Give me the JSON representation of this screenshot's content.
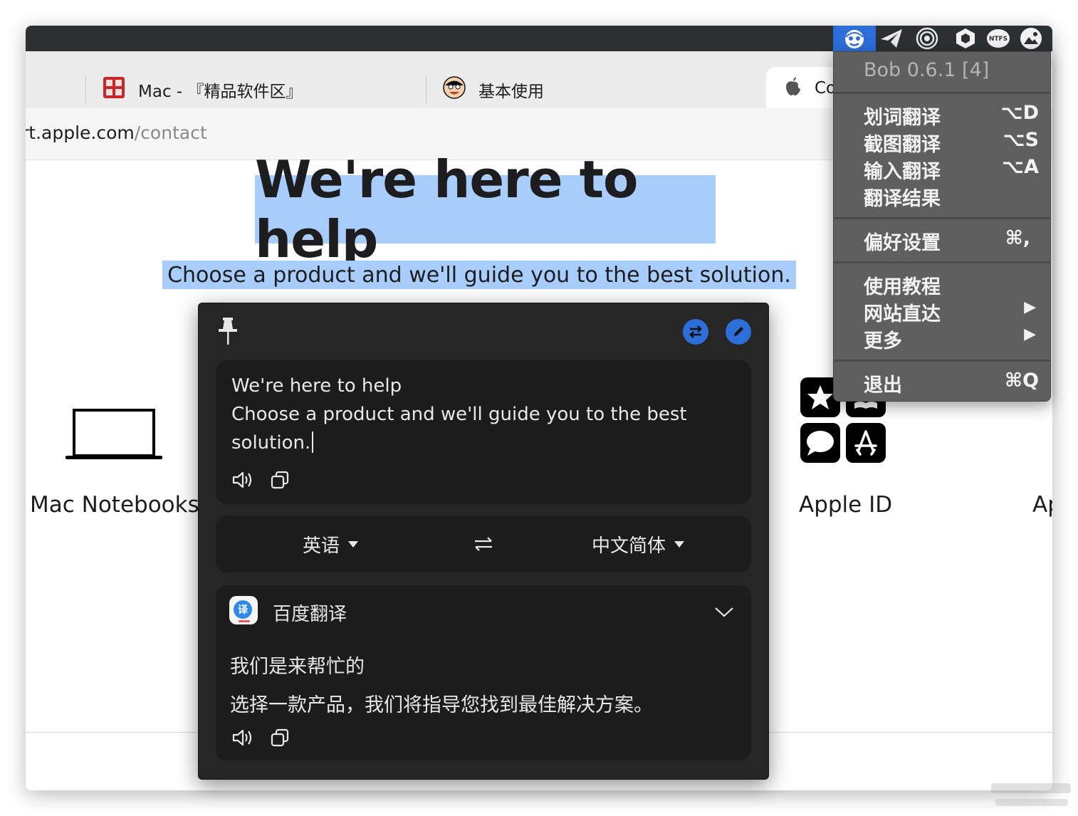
{
  "browser": {
    "tabs": [
      {
        "label": "Mac - 『精品软件区』"
      },
      {
        "label": "基本使用"
      },
      {
        "label": "Co"
      }
    ],
    "address": {
      "host": "rt.apple.com",
      "path": "/contact"
    }
  },
  "page": {
    "title": "We're here to help",
    "subtitle": "Choose a product and we'll guide you to the best solution.",
    "products": [
      {
        "label": "Mac Notebooks"
      },
      {
        "label": "Apple ID"
      },
      {
        "label": "Ap"
      }
    ]
  },
  "bob_window": {
    "input_text": "We're here to help\nChoose a product and we'll guide you to the best solution.",
    "source_lang": "英语",
    "target_lang": "中文简体",
    "service": {
      "name": "百度翻译",
      "result_lines": [
        "我们是来帮忙的",
        "选择一款产品，我们将指导您找到最佳解决方案。"
      ]
    }
  },
  "menu": {
    "title": "Bob 0.6.1 [4]",
    "items": [
      {
        "label": "划词翻译",
        "shortcut": "⌥D"
      },
      {
        "label": "截图翻译",
        "shortcut": "⌥S"
      },
      {
        "label": "输入翻译",
        "shortcut": "⌥A"
      },
      {
        "label": "翻译结果",
        "shortcut": ""
      },
      {
        "label": "偏好设置",
        "shortcut": "⌘,"
      },
      {
        "label": "使用教程",
        "shortcut": ""
      },
      {
        "label": "网站直达",
        "shortcut": "▶"
      },
      {
        "label": "更多",
        "shortcut": "▶"
      },
      {
        "label": "退出",
        "shortcut": "⌘Q"
      }
    ]
  },
  "menubar_icons": [
    "bob-icon",
    "paper-plane-icon",
    "spiral-icon",
    "hexagon-icon",
    "ntfs-icon",
    "photo-icon"
  ],
  "colors": {
    "selection": "#a9cdfa",
    "accent_blue": "#2d6ed8",
    "popup_bg": "#262626"
  }
}
